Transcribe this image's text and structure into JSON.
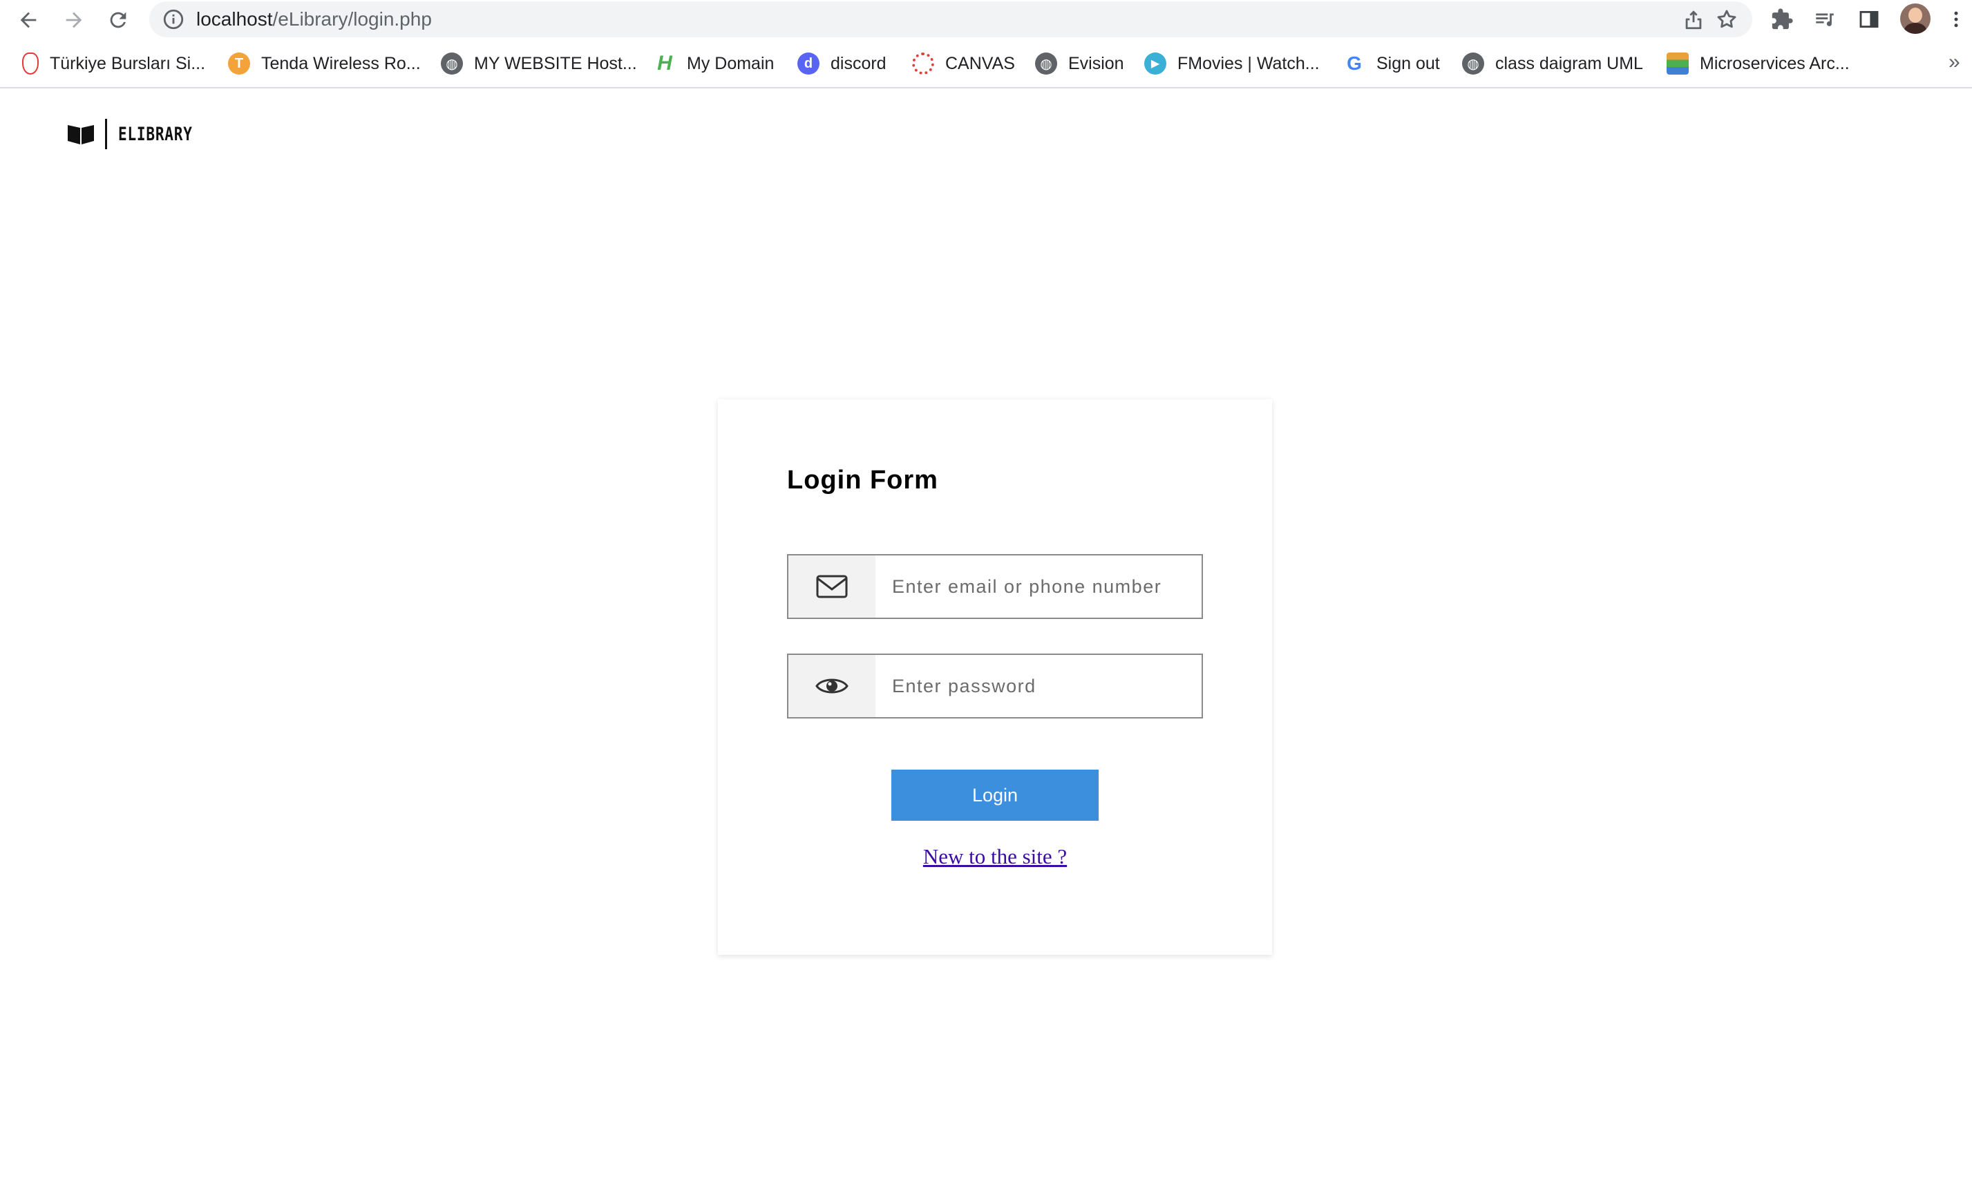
{
  "browser": {
    "url_host": "localhost",
    "url_path": "/eLibrary/login.php"
  },
  "bookmarks": [
    {
      "label": "Türkiye Bursları Si...",
      "icon": "turkiye-burslari-icon",
      "color": "#e53935"
    },
    {
      "label": "Tenda Wireless Ro...",
      "icon": "tenda-icon",
      "color": "#f4a23a"
    },
    {
      "label": "MY WEBSITE Host...",
      "icon": "globe-icon",
      "color": "#5f6368"
    },
    {
      "label": "My Domain",
      "icon": "mydomain-icon",
      "color": "#4caf50"
    },
    {
      "label": "discord",
      "icon": "discord-icon",
      "color": "#5865f2"
    },
    {
      "label": "CANVAS",
      "icon": "canvas-icon",
      "color": "#e0423b"
    },
    {
      "label": "Evision",
      "icon": "globe-icon",
      "color": "#5f6368"
    },
    {
      "label": "FMovies | Watch...",
      "icon": "play-icon",
      "color": "#3ab0d6"
    },
    {
      "label": "Sign out",
      "icon": "google-icon",
      "color": "#4285f4"
    },
    {
      "label": "class daigram UML",
      "icon": "globe-icon",
      "color": "#5f6368"
    },
    {
      "label": "Microservices Arc...",
      "icon": "layers-icon",
      "color": "#e8a03a"
    }
  ],
  "bookmarks_more": "»",
  "logo": {
    "text": "ELIBRARY"
  },
  "login_form": {
    "title": "Login Form",
    "email_placeholder": "Enter email or phone number",
    "password_placeholder": "Enter password",
    "login_label": "Login",
    "signup_link": "New to the site ?"
  },
  "colors": {
    "accent": "#3b8fdc",
    "link": "#3a0ca3"
  }
}
